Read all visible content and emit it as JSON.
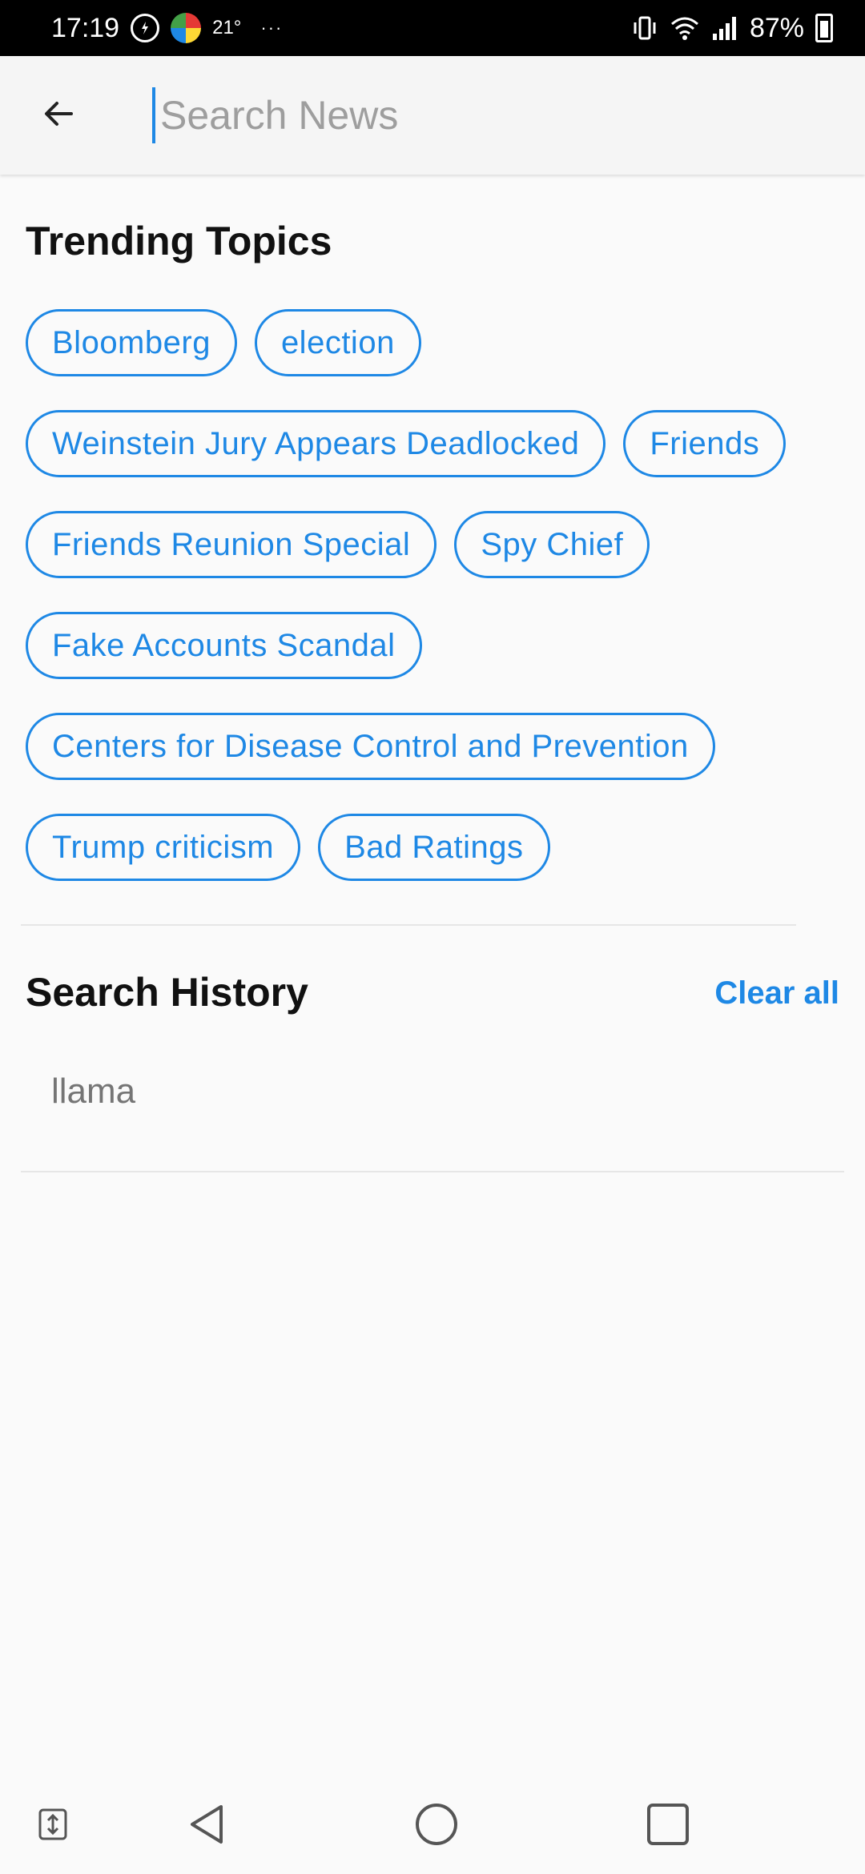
{
  "status_bar": {
    "time": "17:19",
    "temperature": "21°",
    "more": "···",
    "battery": "87%",
    "icons": [
      "data-saver-icon",
      "weather-icon",
      "vibrate-icon",
      "wifi-icon",
      "signal-icon",
      "battery-charging-icon"
    ]
  },
  "app_bar": {
    "back_icon": "arrow-back-icon",
    "search": {
      "value": "",
      "placeholder": "Search News"
    }
  },
  "trending": {
    "title": "Trending Topics",
    "topics": [
      "Bloomberg",
      "election",
      "Weinstein Jury Appears Deadlocked",
      "Friends",
      "Friends Reunion Special",
      "Spy Chief",
      "Fake Accounts Scandal",
      "Centers for Disease Control and Prevention",
      "Trump criticism",
      "Bad Ratings"
    ]
  },
  "history": {
    "title": "Search History",
    "clear_label": "Clear all",
    "items": [
      "llama"
    ]
  },
  "nav_bar": {
    "icons": [
      "screen-switch-icon",
      "back-triangle-icon",
      "home-circle-icon",
      "recents-square-icon"
    ]
  },
  "colors": {
    "accent": "#1e88e5",
    "background": "#fafafa",
    "app_bar": "#f5f5f5"
  }
}
